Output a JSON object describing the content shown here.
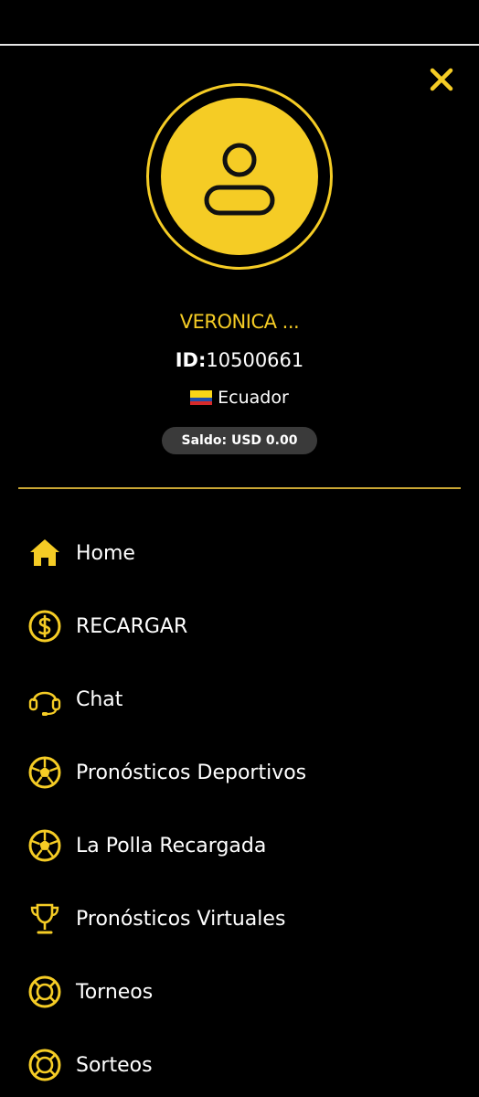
{
  "colors": {
    "accent": "#f5cc25",
    "background": "#000000",
    "pill": "#3a3a3a"
  },
  "header": {
    "close_icon": "close-icon"
  },
  "profile": {
    "avatar_icon": "user-icon",
    "name": "VERONICA ...",
    "id_label": "ID:",
    "id_value": "10500661",
    "country_flag": "ecuador-flag",
    "country": "Ecuador",
    "balance": "Saldo: USD 0.00"
  },
  "menu": {
    "items": [
      {
        "label": "Home",
        "icon": "home-icon"
      },
      {
        "label": "RECARGAR",
        "icon": "dollar-coin-icon"
      },
      {
        "label": "Chat",
        "icon": "headset-icon"
      },
      {
        "label": "Pronósticos Deportivos",
        "icon": "soccer-ball-icon"
      },
      {
        "label": "La Polla Recargada",
        "icon": "soccer-ball-icon"
      },
      {
        "label": "Pronósticos Virtuales",
        "icon": "trophy-icon"
      },
      {
        "label": "Torneos",
        "icon": "lifebuoy-icon"
      },
      {
        "label": "Sorteos",
        "icon": "lifebuoy-icon"
      }
    ]
  }
}
